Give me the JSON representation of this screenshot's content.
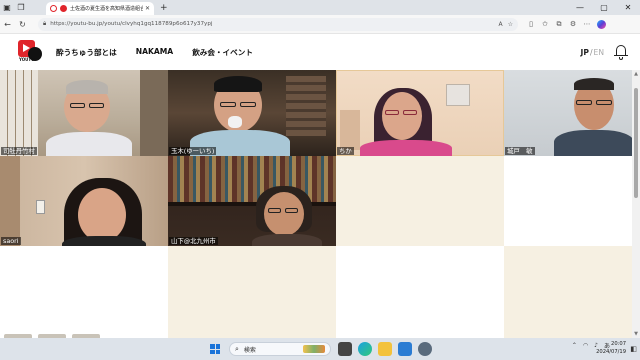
{
  "browser": {
    "tab_title": "土佐酒の夏生酒を高知県酒造組合",
    "url": "https://youtu-bu.jp/youtu/clvyhq1gq118789p6o617y37ypj"
  },
  "site": {
    "logo_text": "YOUTU",
    "nav": [
      "酔うちゅう部とは",
      "NAKAMA",
      "飲み会・イベント"
    ],
    "lang_jp": "JP",
    "lang_sep": "/",
    "lang_en": "EN"
  },
  "participants": [
    {
      "name": "司牡丹竹村"
    },
    {
      "name": "玉木(ゆーいち)"
    },
    {
      "name": "ちか"
    },
    {
      "name": "城戸　敏"
    },
    {
      "name": "saori"
    },
    {
      "name": "山下@北九州市"
    }
  ],
  "taskbar": {
    "search_placeholder": "検索",
    "ime": "あ",
    "time": "20:07",
    "date": "2024/07/19"
  },
  "colors": {
    "brand_red": "#e0252b",
    "empty_tile": "#f6f0e2",
    "active_speaker_border": "#e6c898"
  }
}
